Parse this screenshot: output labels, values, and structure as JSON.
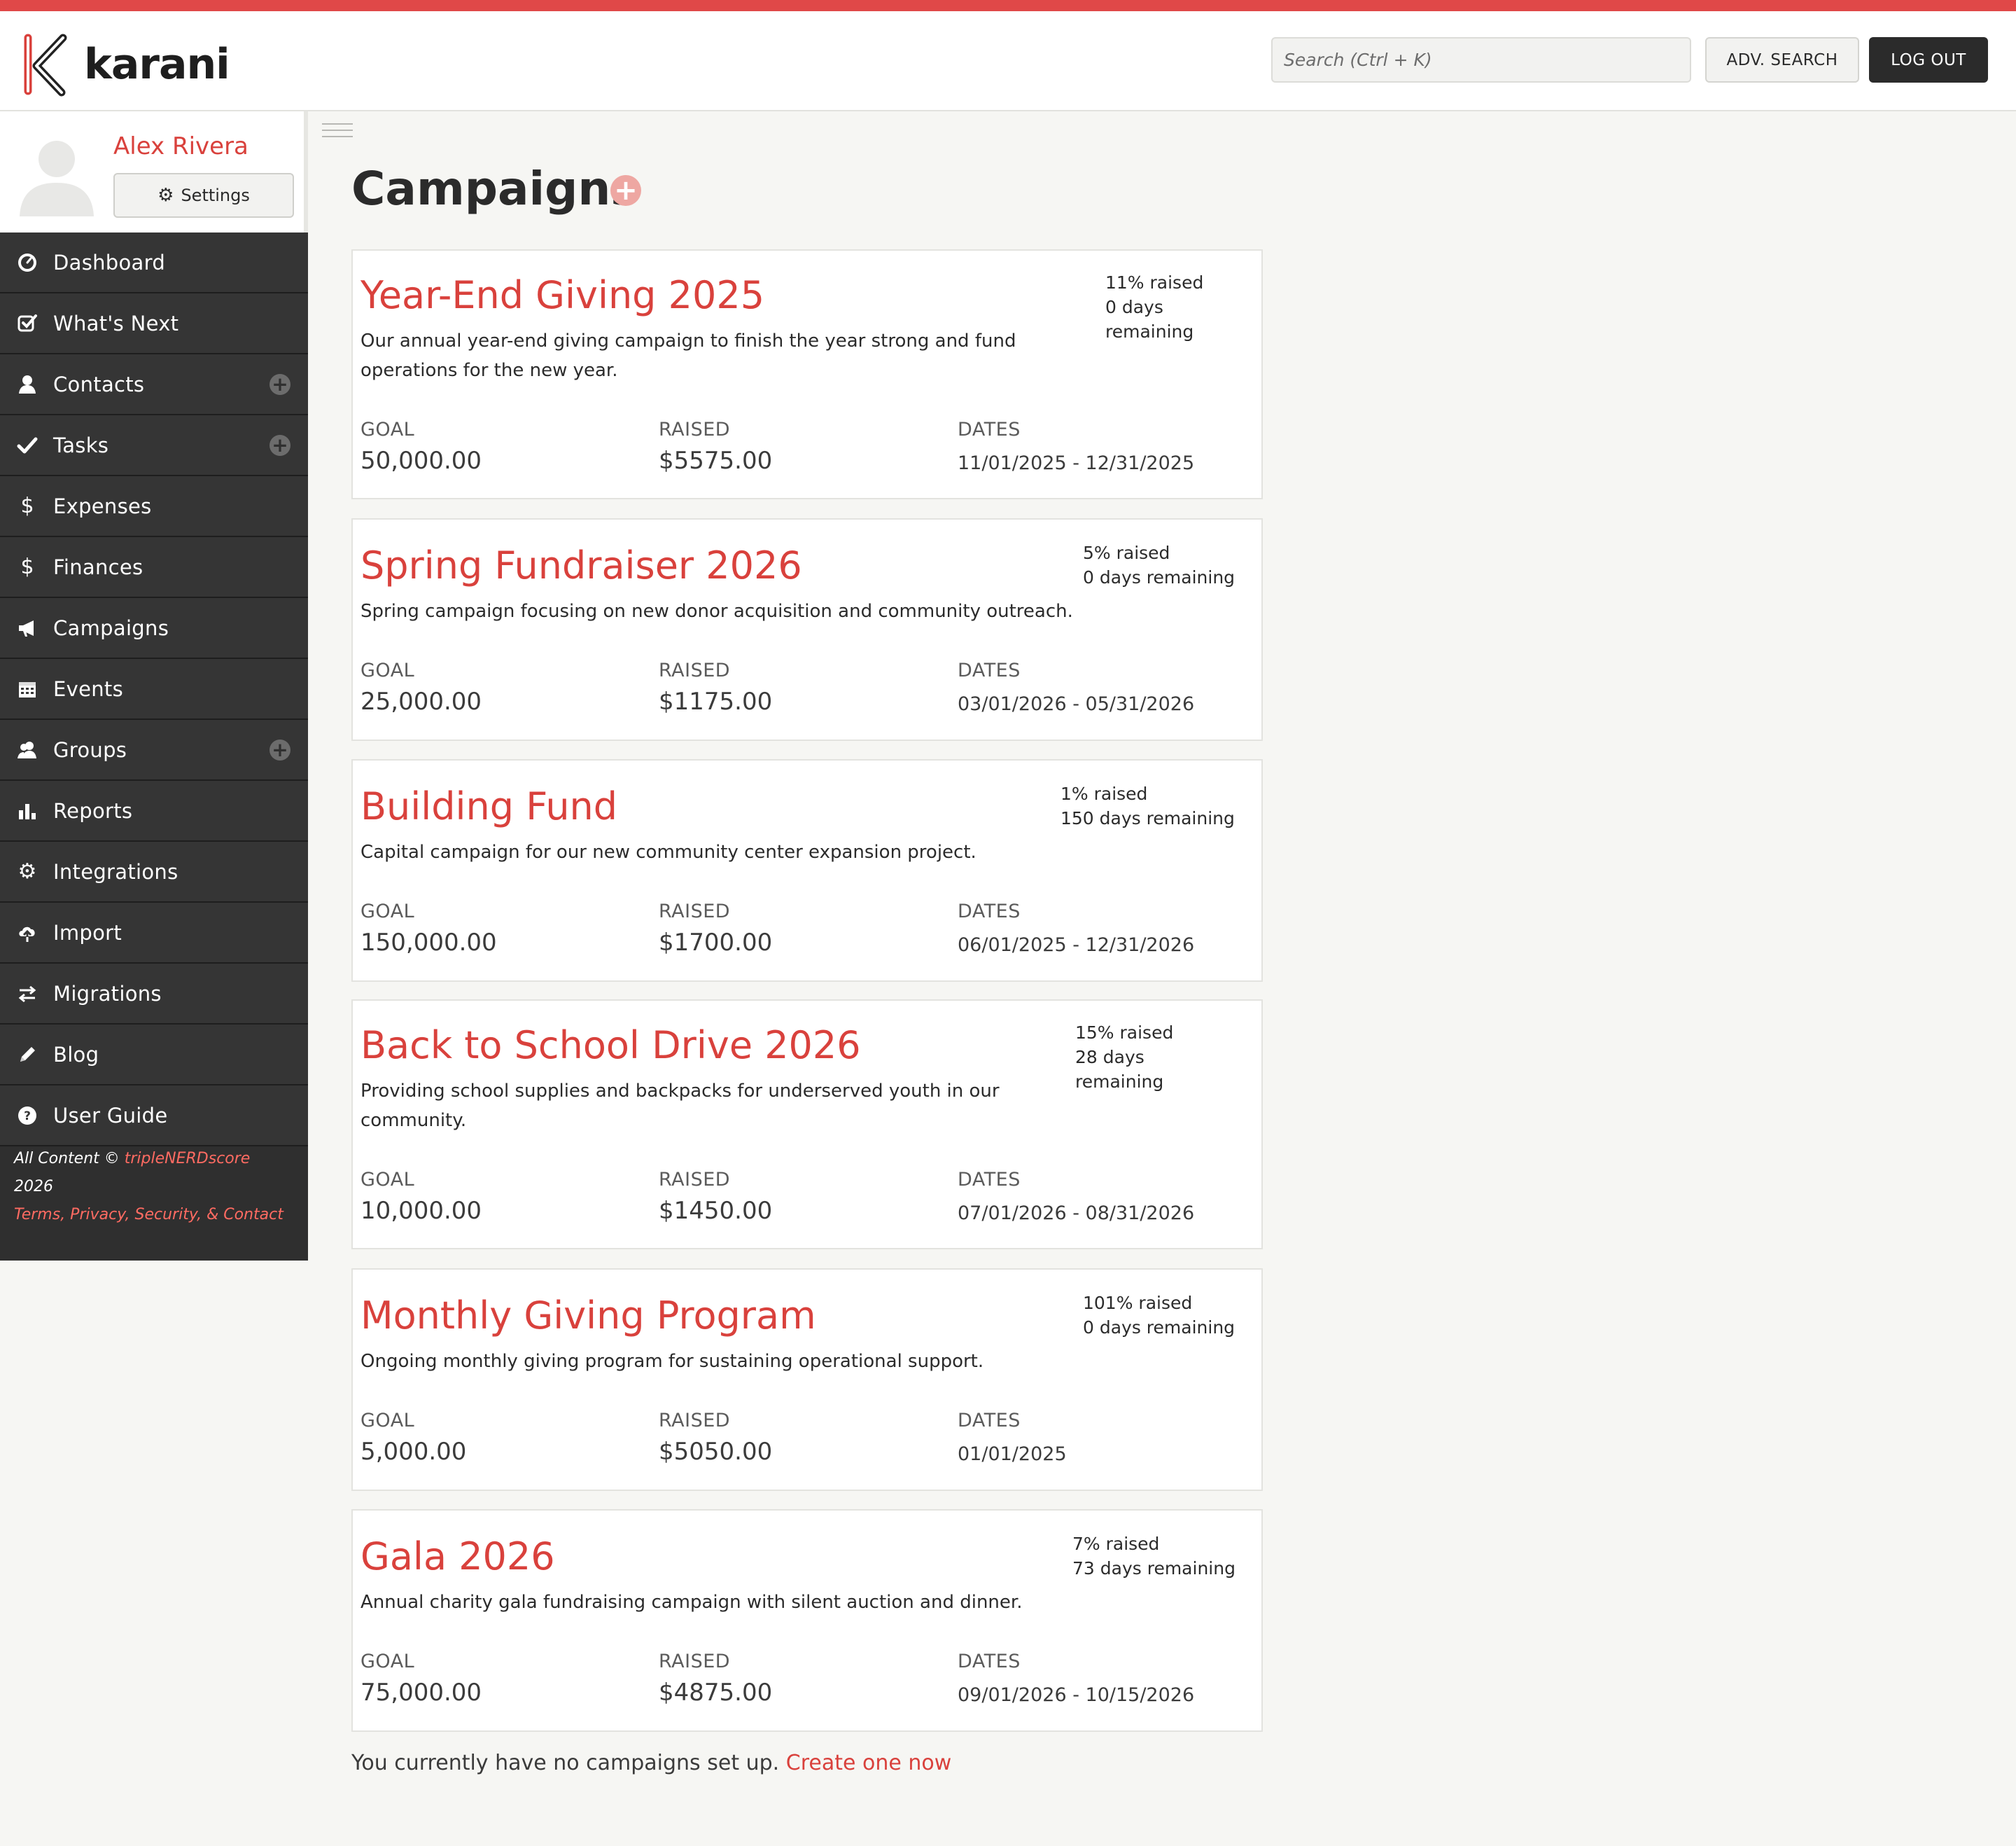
{
  "app": {
    "name": "karani"
  },
  "header": {
    "search_placeholder": "Search (Ctrl + K)",
    "adv_search_label": "ADV. SEARCH",
    "logout_label": "LOG OUT"
  },
  "profile": {
    "name": "Alex Rivera",
    "settings_label": "Settings"
  },
  "sidebar": {
    "items": [
      {
        "label": "Dashboard",
        "icon": "dashboard-icon"
      },
      {
        "label": "What's Next",
        "icon": "checkbox-icon"
      },
      {
        "label": "Contacts",
        "icon": "user-icon",
        "has_add": true
      },
      {
        "label": "Tasks",
        "icon": "checkmark-icon",
        "has_add": true
      },
      {
        "label": "Expenses",
        "icon": "dollar-icon"
      },
      {
        "label": "Finances",
        "icon": "dollar-icon"
      },
      {
        "label": "Campaigns",
        "icon": "megaphone-icon"
      },
      {
        "label": "Events",
        "icon": "calendar-icon"
      },
      {
        "label": "Groups",
        "icon": "group-icon",
        "has_add": true
      },
      {
        "label": "Reports",
        "icon": "bar-chart-icon"
      },
      {
        "label": "Integrations",
        "icon": "gear-icon"
      },
      {
        "label": "Import",
        "icon": "cloud-upload-icon"
      },
      {
        "label": "Migrations",
        "icon": "transfer-icon"
      },
      {
        "label": "Blog",
        "icon": "pencil-icon"
      },
      {
        "label": "User Guide",
        "icon": "question-icon"
      }
    ]
  },
  "footer": {
    "prefix": "All Content © ",
    "brand": "tripleNERDscore",
    "year": " 2026",
    "links": "Terms, Privacy, Security, & Contact"
  },
  "page": {
    "title": "Campaigns"
  },
  "labels": {
    "goal": "GOAL",
    "raised": "RAISED",
    "dates": "DATES"
  },
  "campaigns": [
    {
      "title": "Year-End Giving 2025",
      "description": "Our annual year-end giving campaign to finish the year strong and fund operations for the new year.",
      "raised_pct": "11% raised",
      "days_remaining": "0 days remaining",
      "goal": "50,000.00",
      "raised": "$5575.00",
      "dates": "11/01/2025 - 12/31/2025"
    },
    {
      "title": "Spring Fundraiser 2026",
      "description": "Spring campaign focusing on new donor acquisition and community outreach.",
      "raised_pct": "5% raised",
      "days_remaining": "0 days remaining",
      "goal": "25,000.00",
      "raised": "$1175.00",
      "dates": "03/01/2026 - 05/31/2026"
    },
    {
      "title": "Building Fund",
      "description": "Capital campaign for our new community center expansion project.",
      "raised_pct": "1% raised",
      "days_remaining": "150 days remaining",
      "goal": "150,000.00",
      "raised": "$1700.00",
      "dates": "06/01/2025 - 12/31/2026"
    },
    {
      "title": "Back to School Drive 2026",
      "description": "Providing school supplies and backpacks for underserved youth in our community.",
      "raised_pct": "15% raised",
      "days_remaining": "28 days remaining",
      "goal": "10,000.00",
      "raised": "$1450.00",
      "dates": "07/01/2026 - 08/31/2026"
    },
    {
      "title": "Monthly Giving Program",
      "description": "Ongoing monthly giving program for sustaining operational support.",
      "raised_pct": "101% raised",
      "days_remaining": "0 days remaining",
      "goal": "5,000.00",
      "raised": "$5050.00",
      "dates": "01/01/2025"
    },
    {
      "title": "Gala 2026",
      "description": "Annual charity gala fundraising campaign with silent auction and dinner.",
      "raised_pct": "7% raised",
      "days_remaining": "73 days remaining",
      "goal": "75,000.00",
      "raised": "$4875.00",
      "dates": "09/01/2026 - 10/15/2026"
    }
  ],
  "empty_state": {
    "text": "You currently have no campaigns set up. ",
    "link": "Create one now"
  },
  "colors": {
    "accent": "#e04848",
    "link": "#d9413c",
    "sidebar_bg": "#2f2f2f"
  }
}
